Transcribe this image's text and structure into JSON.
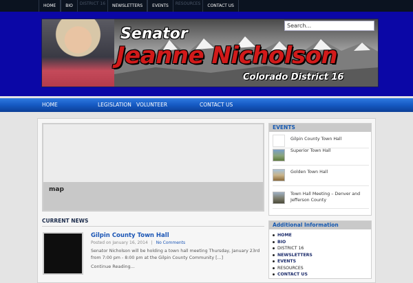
{
  "topnav": {
    "items": [
      "HOME",
      "BIO",
      "DISTRICT 16",
      "NEWSLETTERS",
      "EVENTS",
      "RESOURCES",
      "CONTACT US"
    ]
  },
  "header": {
    "title_line1": "Senator",
    "title_line2": "Jeanne Nicholson",
    "subtitle": "Colorado District 16",
    "search_placeholder": "Search..."
  },
  "mainnav": {
    "items": [
      "HOME",
      "LEGISLATION",
      "VOLUNTEER",
      "CONTACT US"
    ]
  },
  "map": {
    "label": "map"
  },
  "news": {
    "heading": "CURRENT NEWS",
    "post": {
      "title": "Gilpin County Town Hall",
      "posted_on": "Posted on January 16, 2014",
      "separator": "|",
      "comments": "No Comments",
      "excerpt": "Senator Nicholson will be holding a town hall meeting Thursday, January 23rd from 7:00 pm - 8:00 pm at the Gilpin County Community [...]",
      "more": "Continue Reading..."
    }
  },
  "events": {
    "heading": "EVENTS",
    "items": [
      "Gilpin County Town Hall",
      "Superior Town Hall",
      "Golden Town Hall",
      "Town Hall Meeting – Denver and Jefferson County"
    ]
  },
  "info": {
    "heading": "Additional Information",
    "items": [
      "HOME",
      "BIO",
      "DISTRICT 16",
      "NEWSLETTERS",
      "EVENTS",
      "RESOURCES",
      "CONTACT US"
    ]
  },
  "colors": {
    "header_blue": "#0b07a6",
    "nav_blue": "#1559c2",
    "link_blue": "#1a55b5",
    "name_red": "#d11a1a"
  }
}
